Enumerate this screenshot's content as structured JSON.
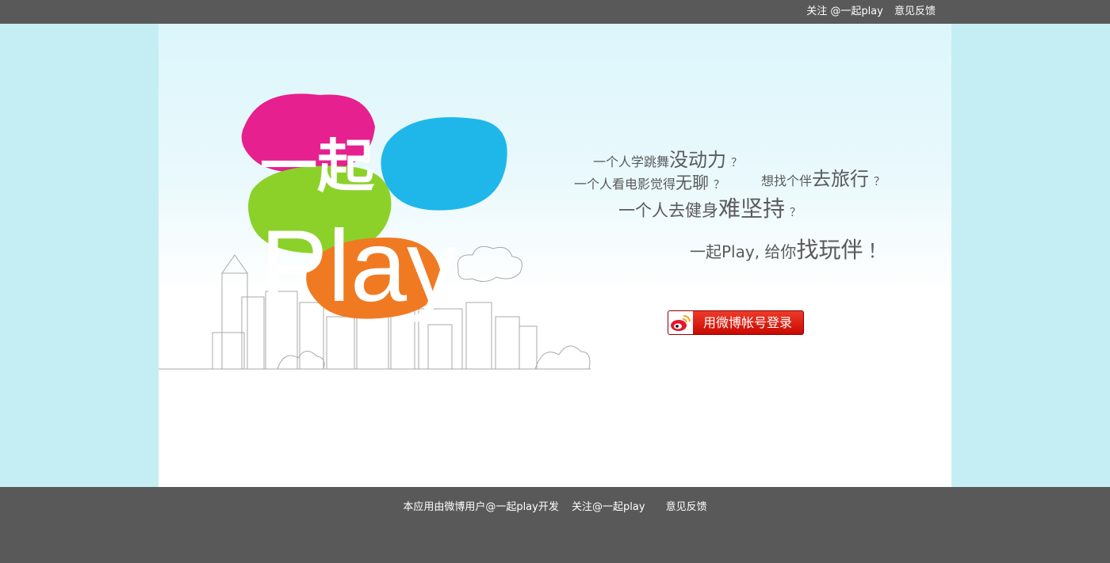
{
  "header": {
    "follow_link": "关注 @一起play",
    "feedback_link": "意见反馈"
  },
  "hero": {
    "logo_text_top": "一起",
    "logo_text_bottom": "Play",
    "taglines": [
      {
        "prefix": "一个人学跳舞",
        "emphasis": "没动力",
        "suffix": "？"
      },
      {
        "prefix": "一个人看电影觉得",
        "emphasis": "无聊",
        "suffix": "？"
      },
      {
        "prefix": "想找个伴",
        "emphasis": "去旅行",
        "suffix": "？"
      },
      {
        "prefix": "一个人去健身",
        "emphasis": "难坚持",
        "suffix": "？"
      },
      {
        "prefix": "一起Play, 给你",
        "emphasis": "找玩伴",
        "suffix": "！"
      }
    ],
    "login_button": "用微博帐号登录"
  },
  "footer": {
    "developer_note": "本应用由微博用户@一起play开发",
    "follow_link": "关注@一起play",
    "feedback_link": "意见反馈"
  },
  "colors": {
    "bar": "#595959",
    "page_bg": "#c4eef4",
    "pink": "#e6208f",
    "blue": "#1fb7ea",
    "green": "#8cd12a",
    "orange": "#f07a22",
    "login_red": "#d3180c"
  }
}
